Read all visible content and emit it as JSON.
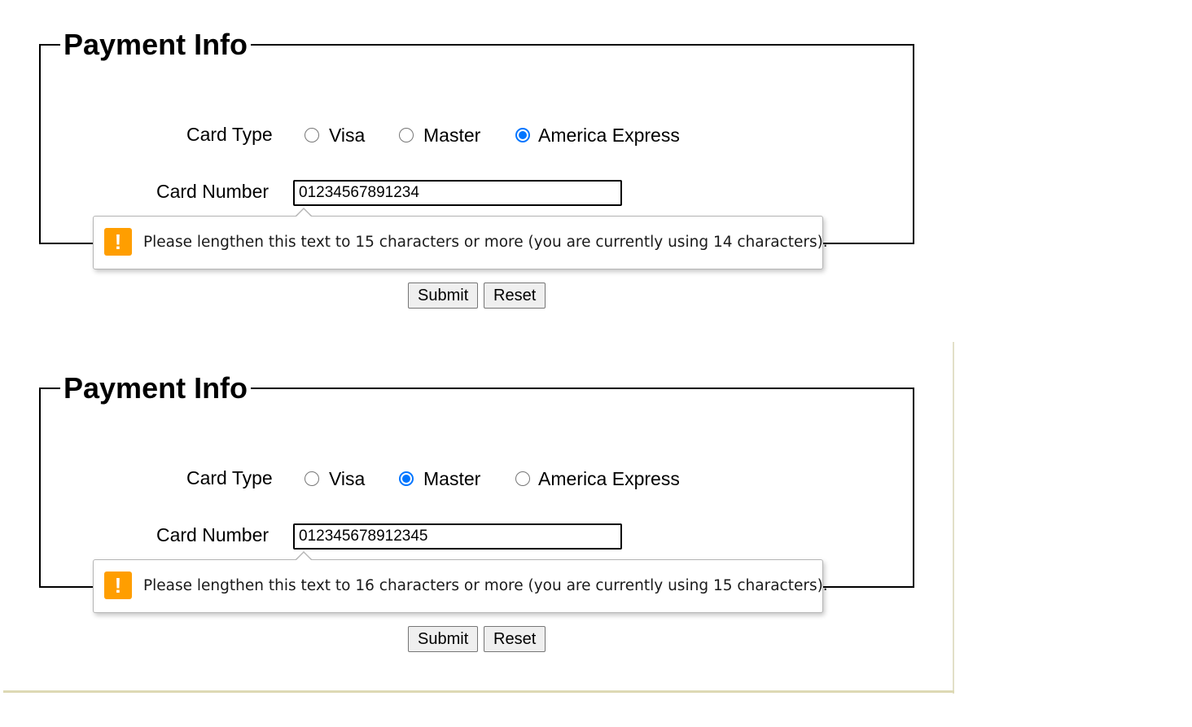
{
  "forms": [
    {
      "legend": "Payment Info",
      "card_type_label": "Card Type",
      "card_types": [
        {
          "label": "Visa",
          "checked": false
        },
        {
          "label": "Master",
          "checked": false
        },
        {
          "label": "America Express",
          "checked": true
        }
      ],
      "card_number_label": "Card Number",
      "card_number_value": "01234567891234",
      "validation_message": "Please lengthen this text to 15 characters or more (you are currently using 14 characters).",
      "warning_symbol": "!",
      "submit_label": "Submit",
      "reset_label": "Reset"
    },
    {
      "legend": "Payment Info",
      "card_type_label": "Card Type",
      "card_types": [
        {
          "label": "Visa",
          "checked": false
        },
        {
          "label": "Master",
          "checked": true
        },
        {
          "label": "America Express",
          "checked": false
        }
      ],
      "card_number_label": "Card Number",
      "card_number_value": "012345678912345",
      "validation_message": "Please lengthen this text to 16 characters or more (you are currently using 15 characters).",
      "warning_symbol": "!",
      "submit_label": "Submit",
      "reset_label": "Reset"
    }
  ],
  "colors": {
    "radio_checked": "#0075ff",
    "warning_icon": "#ff9e00"
  },
  "icons": {
    "warning": "warning-icon"
  }
}
